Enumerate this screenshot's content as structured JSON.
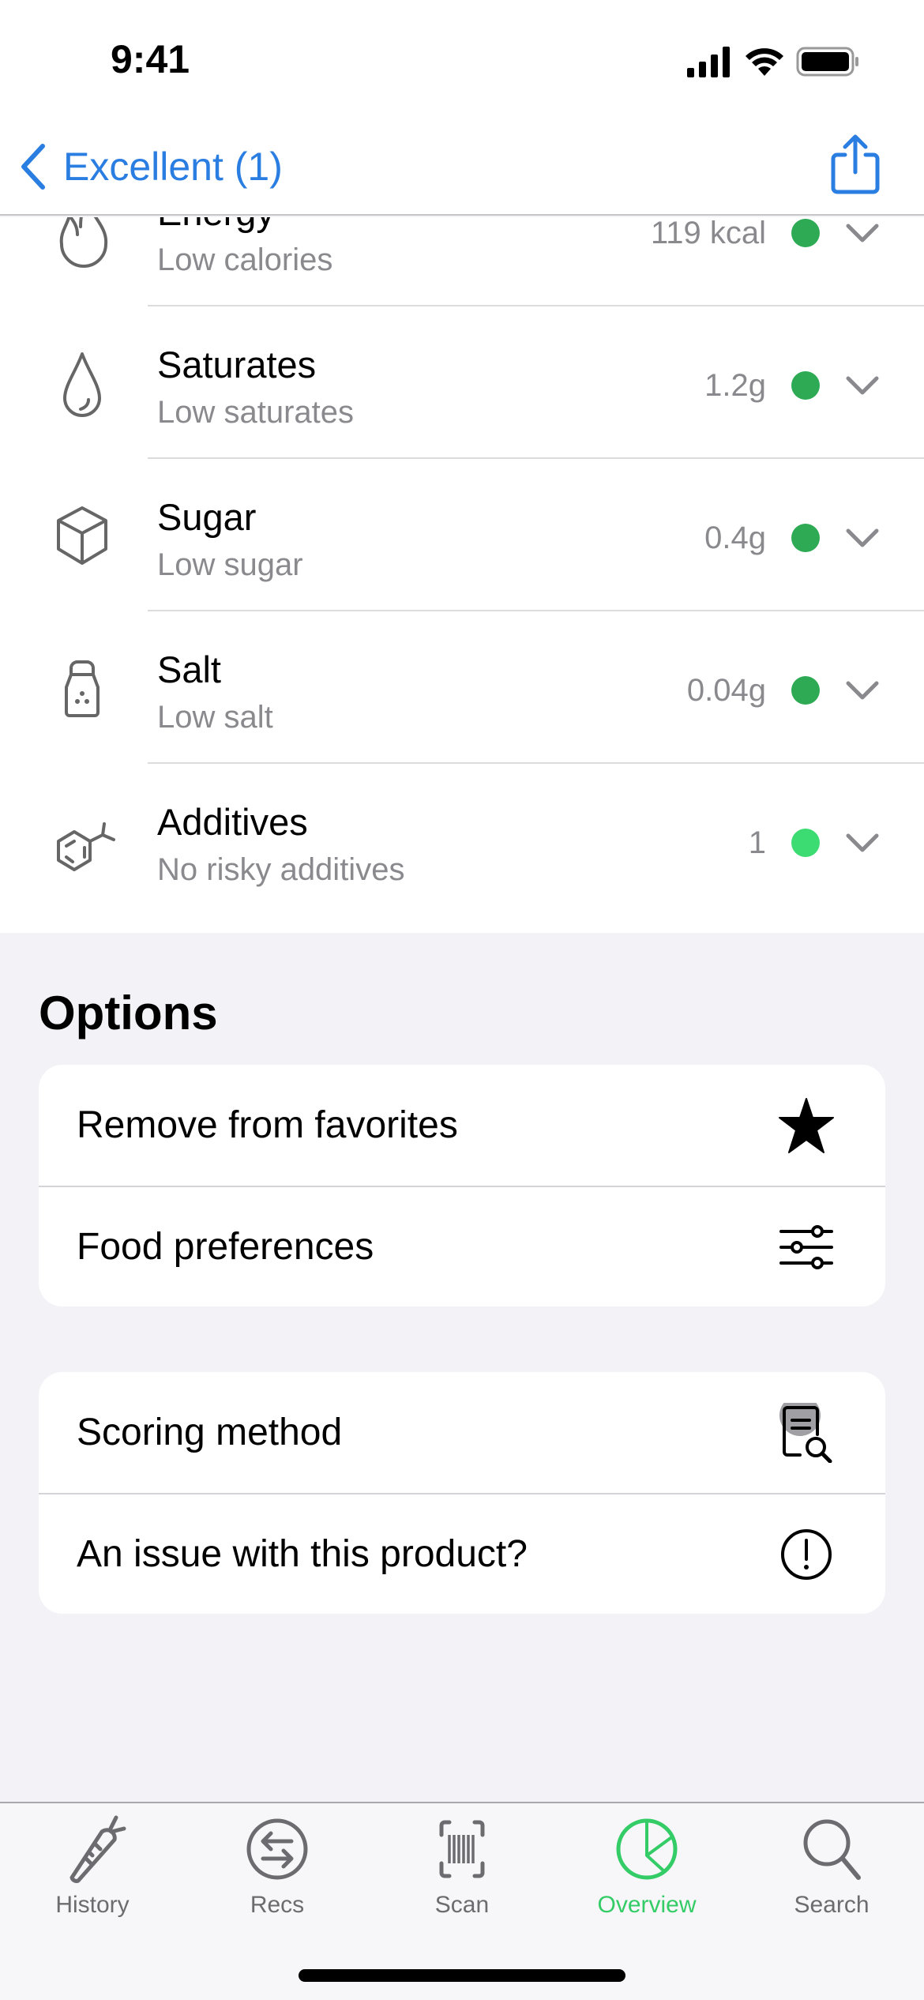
{
  "status_bar": {
    "time": "9:41",
    "icons": [
      "cellular-signal-icon",
      "wifi-icon",
      "battery-icon"
    ]
  },
  "nav": {
    "back_label": "Excellent (1)",
    "back_icon": "chevron-left-icon",
    "action_icon": "share-icon",
    "accent_color": "#2a7de1"
  },
  "nutrients": [
    {
      "name": "Energy",
      "description": "Low calories",
      "value": "119 kcal",
      "status_color": "#2eaa55",
      "icon": "flame-icon"
    },
    {
      "name": "Saturates",
      "description": "Low saturates",
      "value": "1.2g",
      "status_color": "#2eaa55",
      "icon": "droplet-icon"
    },
    {
      "name": "Sugar",
      "description": "Low sugar",
      "value": "0.4g",
      "status_color": "#2eaa55",
      "icon": "sugar-cube-icon"
    },
    {
      "name": "Salt",
      "description": "Low salt",
      "value": "0.04g",
      "status_color": "#2eaa55",
      "icon": "salt-shaker-icon"
    },
    {
      "name": "Additives",
      "description": "No risky additives",
      "value": "1",
      "status_color": "#3ddc72",
      "icon": "molecule-icon"
    }
  ],
  "options": {
    "title": "Options",
    "group1": [
      {
        "label": "Remove from favorites",
        "icon": "star-filled-icon"
      },
      {
        "label": "Food preferences",
        "icon": "sliders-icon"
      }
    ],
    "group2": [
      {
        "label": "Scoring method",
        "icon": "document-search-icon"
      },
      {
        "label": "An issue with this product?",
        "icon": "exclamation-circle-icon"
      }
    ]
  },
  "tab_bar": {
    "active": "Overview",
    "active_color": "#33cc66",
    "tabs": [
      {
        "label": "History",
        "icon": "carrot-icon"
      },
      {
        "label": "Recs",
        "icon": "arrows-exchange-icon"
      },
      {
        "label": "Scan",
        "icon": "barcode-scan-icon"
      },
      {
        "label": "Overview",
        "icon": "pie-chart-icon"
      },
      {
        "label": "Search",
        "icon": "magnifier-icon"
      }
    ]
  }
}
